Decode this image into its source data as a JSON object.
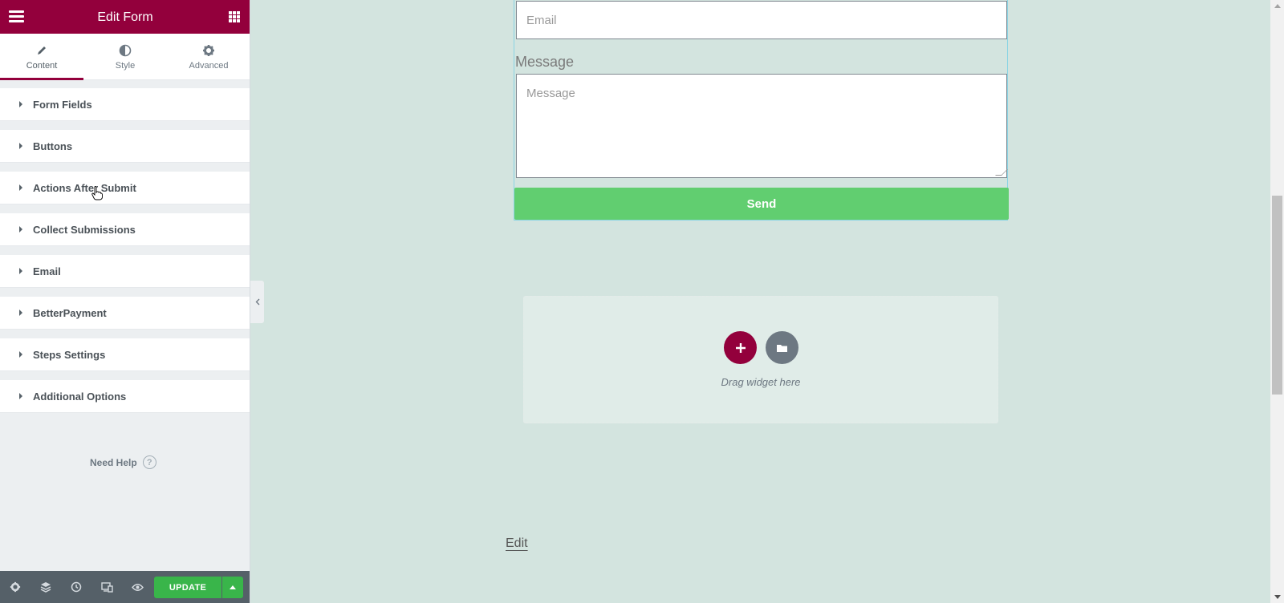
{
  "panel": {
    "title": "Edit Form",
    "tabs": [
      {
        "label": "Content",
        "icon": "pencil-icon"
      },
      {
        "label": "Style",
        "icon": "half-circle-icon"
      },
      {
        "label": "Advanced",
        "icon": "gear-icon"
      }
    ],
    "sections": [
      {
        "label": "Form Fields"
      },
      {
        "label": "Buttons"
      },
      {
        "label": "Actions After Submit"
      },
      {
        "label": "Collect Submissions"
      },
      {
        "label": "Email"
      },
      {
        "label": "BetterPayment"
      },
      {
        "label": "Steps Settings"
      },
      {
        "label": "Additional Options"
      }
    ],
    "help": "Need Help",
    "footer": {
      "update_label": "UPDATE",
      "icons": [
        "settings-icon",
        "layers-icon",
        "history-icon",
        "responsive-icon",
        "preview-icon"
      ]
    }
  },
  "form": {
    "email_placeholder": "Email",
    "message_label": "Message",
    "message_placeholder": "Message",
    "send_label": "Send"
  },
  "dropzone": {
    "text": "Drag widget here"
  },
  "edit_link": "Edit",
  "colors": {
    "brand": "#93003c",
    "send_button": "#61ce70",
    "update_button": "#39b54a",
    "canvas_bg": "#d3e4df"
  }
}
